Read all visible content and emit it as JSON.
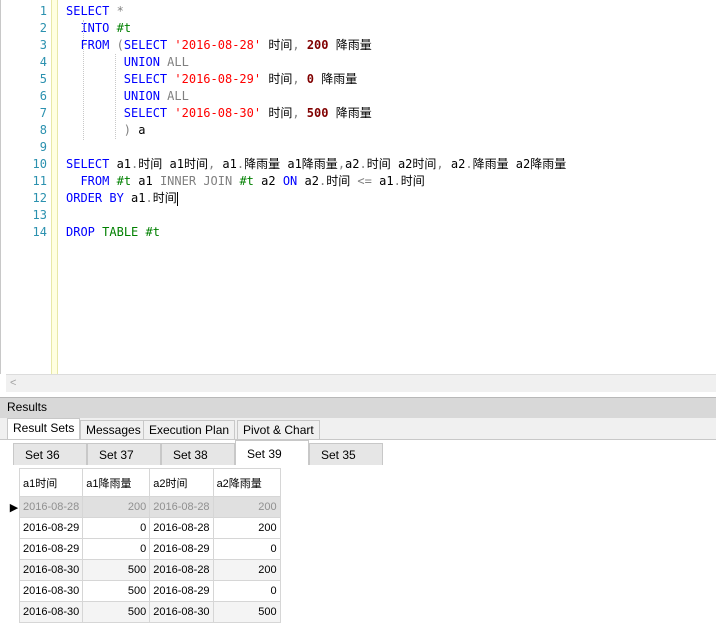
{
  "editor": {
    "line_numbers": [
      "1",
      "2",
      "3",
      "4",
      "5",
      "6",
      "7",
      "8",
      "9",
      "10",
      "11",
      "12",
      "13",
      "14"
    ]
  },
  "results": {
    "title": "Results",
    "outer_tabs": [
      "Result Sets",
      "Messages",
      "Execution Plan",
      "Pivot & Chart"
    ],
    "inner_tabs": [
      "Set 36",
      "Set 37",
      "Set 38",
      "Set 39",
      "Set 35"
    ],
    "columns": [
      "a1时间",
      "a1降雨量",
      "a2时间",
      "a2降雨量"
    ],
    "rows": [
      [
        "2016-08-28",
        "200",
        "2016-08-28",
        "200"
      ],
      [
        "2016-08-29",
        "0",
        "2016-08-28",
        "200"
      ],
      [
        "2016-08-29",
        "0",
        "2016-08-29",
        "0"
      ],
      [
        "2016-08-30",
        "500",
        "2016-08-28",
        "200"
      ],
      [
        "2016-08-30",
        "500",
        "2016-08-29",
        "0"
      ],
      [
        "2016-08-30",
        "500",
        "2016-08-30",
        "500"
      ]
    ],
    "row_marker": "▶"
  },
  "scrollbar": {
    "left_arrow": "<"
  }
}
